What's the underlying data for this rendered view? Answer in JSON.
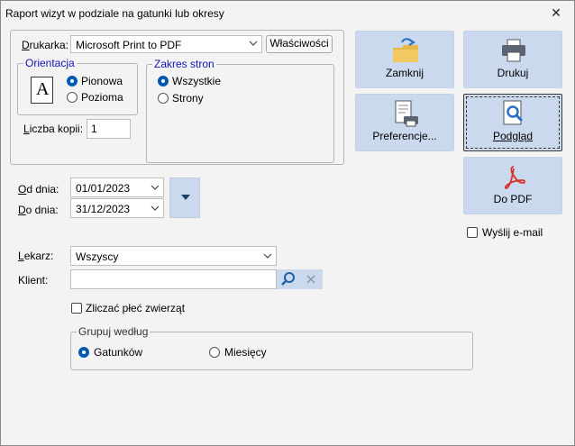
{
  "window": {
    "title": "Raport wizyt w podziale na gatunki  lub okresy",
    "close_glyph": "✕"
  },
  "printer": {
    "label": "Drukarka:",
    "selected": "Microsoft Print to PDF",
    "properties_label": "Właściwości"
  },
  "orientation": {
    "legend": "Orientacja",
    "options": [
      {
        "label": "Pionowa",
        "checked": true
      },
      {
        "label": "Pozioma",
        "checked": false
      }
    ],
    "icon_letter": "A"
  },
  "page_range": {
    "legend": "Zakres stron",
    "options": [
      {
        "label": "Wszystkie",
        "checked": true
      },
      {
        "label": "Strony",
        "checked": false
      }
    ]
  },
  "copies": {
    "label": "Liczba kopii:",
    "value": "1"
  },
  "buttons": {
    "close": "Zamknij",
    "print": "Drukuj",
    "preferences": "Preferencje...",
    "preview": "Podgląd",
    "pdf": "Do PDF"
  },
  "email": {
    "label": "Wyślij e-mail",
    "checked": false
  },
  "dates": {
    "from_label": "Od dnia:",
    "from_value": "01/01/2023",
    "to_label": "Do dnia:",
    "to_value": "31/12/2023"
  },
  "doctor": {
    "label": "Lekarz:",
    "selected": "Wszyscy"
  },
  "client": {
    "label": "Klient:",
    "value": ""
  },
  "count_sex": {
    "label": "Zliczać płeć zwierząt",
    "checked": false
  },
  "group_by": {
    "legend": "Grupuj według",
    "options": [
      {
        "label": "Gatunków",
        "checked": true
      },
      {
        "label": "Miesięcy",
        "checked": false
      }
    ]
  },
  "colors": {
    "accent": "#0058b0",
    "big_button_bg": "#cbd9ee",
    "legend_blue": "#1414b4",
    "pdf_red": "#d9302a",
    "folder_yellow": "#e8b84a"
  }
}
